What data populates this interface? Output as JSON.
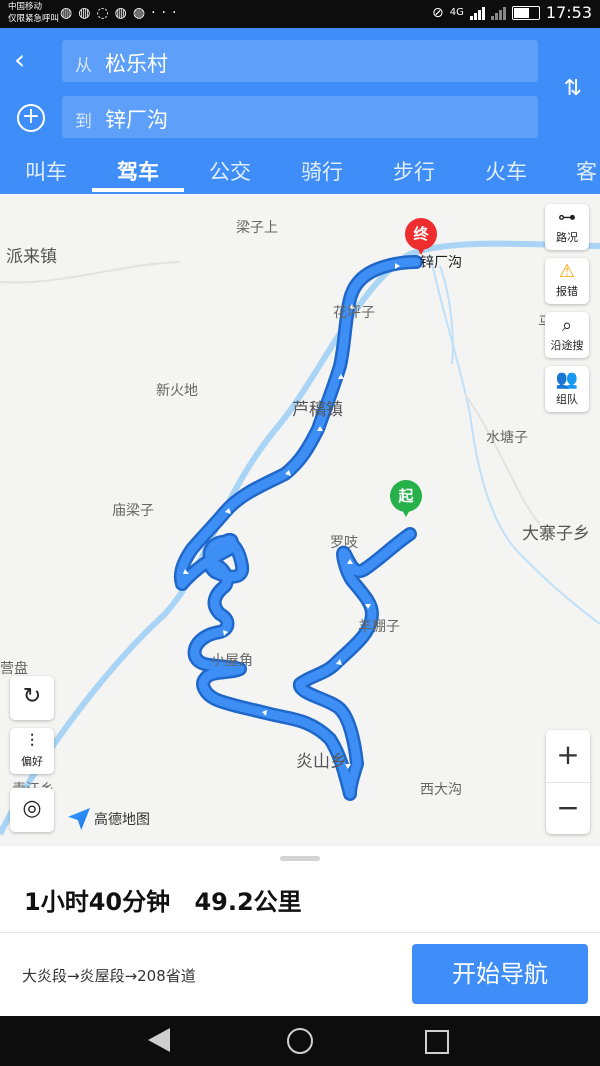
{
  "status_bar": {
    "carrier_line1": "中国移动",
    "carrier_line2": "仅限紧急呼叫",
    "notification_icons": [
      "wechat-icon",
      "wechat-icon",
      "message-icon",
      "wechat-icon",
      "wechat-icon",
      "more-icon"
    ],
    "notification_more": "···",
    "network": "4G",
    "time": "17:53"
  },
  "route_form": {
    "from_prefix": "从",
    "from_value": "松乐村",
    "to_prefix": "到",
    "to_value": "锌厂沟"
  },
  "tabs": [
    {
      "label": "叫车",
      "active": false
    },
    {
      "label": "驾车",
      "active": true
    },
    {
      "label": "公交",
      "active": false
    },
    {
      "label": "骑行",
      "active": false
    },
    {
      "label": "步行",
      "active": false
    },
    {
      "label": "火车",
      "active": false
    },
    {
      "label": "客",
      "active": false
    }
  ],
  "map": {
    "end_pin": "终",
    "start_pin": "起",
    "labels": {
      "l1": "梁子上",
      "l2": "派来镇",
      "l3": "锌厂沟",
      "l4": "花坪子",
      "l5": "芦稿镇",
      "l6": "新火地",
      "l7": "水塘子",
      "l8": "庙梁子",
      "l9": "罗吱",
      "l10": "大寨子乡",
      "l11": "羊棚子",
      "l12": "营盘",
      "l13": "小屋角",
      "l14": "炎山乡",
      "l15": "西大沟",
      "l16": "青江乡",
      "l17": "马"
    },
    "side_buttons": [
      {
        "label": "路况",
        "icon": "traffic-icon"
      },
      {
        "label": "报错",
        "icon": "warning-icon"
      },
      {
        "label": "沿途搜",
        "icon": "search-icon"
      },
      {
        "label": "组队",
        "icon": "team-icon"
      }
    ],
    "left_buttons": {
      "refresh_icon": "refresh-icon",
      "prefs_label": "偏好",
      "locate_icon": "locate-icon"
    },
    "logo_text": "高德地图",
    "zoom_in": "+",
    "zoom_out": "−",
    "route_color": "#2e7cf0",
    "river_color": "#a9d4f5"
  },
  "summary": {
    "duration": "1小时40分钟",
    "distance": "49.2公里",
    "roads": "大炎段→炎屋段→208省道",
    "start_button": "开始导航"
  }
}
